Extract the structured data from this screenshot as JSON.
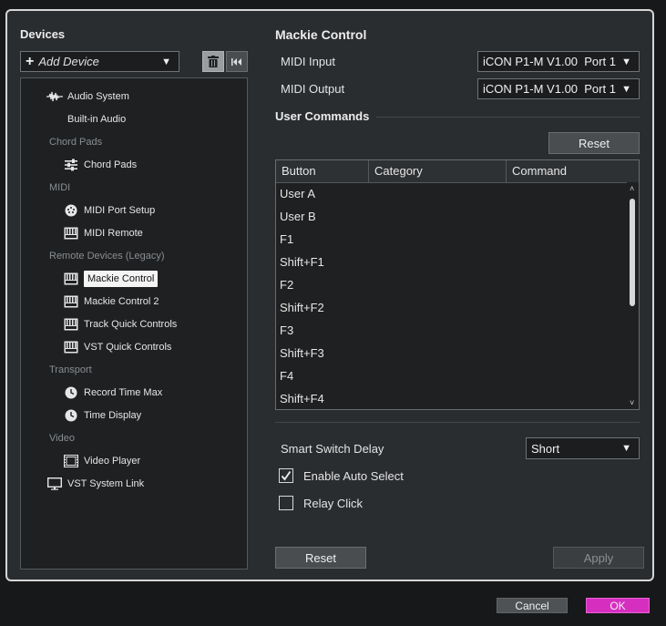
{
  "devices": {
    "title": "Devices",
    "add_device_label": "Add Device",
    "tree": [
      {
        "label": "Audio System",
        "kind": "item",
        "icon": "audio-waveform-icon",
        "indent": 1
      },
      {
        "label": "Built-in Audio",
        "kind": "item",
        "icon": "",
        "indent": 2
      },
      {
        "label": "Chord Pads",
        "kind": "category",
        "icon": "",
        "indent": 1
      },
      {
        "label": "Chord Pads",
        "kind": "item",
        "icon": "sliders-icon",
        "indent": 2
      },
      {
        "label": "MIDI",
        "kind": "category",
        "icon": "",
        "indent": 1
      },
      {
        "label": "MIDI Port Setup",
        "kind": "item",
        "icon": "midi-port-icon",
        "indent": 2
      },
      {
        "label": "MIDI Remote",
        "kind": "item",
        "icon": "keyboard-icon",
        "indent": 2
      },
      {
        "label": "Remote Devices (Legacy)",
        "kind": "category",
        "icon": "",
        "indent": 1
      },
      {
        "label": "Mackie Control",
        "kind": "item",
        "icon": "keyboard-icon",
        "indent": 2,
        "selected": true
      },
      {
        "label": "Mackie Control 2",
        "kind": "item",
        "icon": "keyboard-icon",
        "indent": 2
      },
      {
        "label": "Track Quick Controls",
        "kind": "item",
        "icon": "keyboard-icon",
        "indent": 2
      },
      {
        "label": "VST Quick Controls",
        "kind": "item",
        "icon": "keyboard-icon",
        "indent": 2
      },
      {
        "label": "Transport",
        "kind": "category",
        "icon": "",
        "indent": 1
      },
      {
        "label": "Record Time Max",
        "kind": "item",
        "icon": "clock-icon",
        "indent": 2
      },
      {
        "label": "Time Display",
        "kind": "item",
        "icon": "clock-icon",
        "indent": 2
      },
      {
        "label": "Video",
        "kind": "category",
        "icon": "",
        "indent": 1
      },
      {
        "label": "Video Player",
        "kind": "item",
        "icon": "film-icon",
        "indent": 2
      },
      {
        "label": "VST System Link",
        "kind": "item",
        "icon": "monitor-icon",
        "indent": 1
      }
    ]
  },
  "panel": {
    "title": "Mackie Control",
    "midi_input_label": "MIDI Input",
    "midi_input_value": "iCON P1-M V1.00  Port 1",
    "midi_output_label": "MIDI Output",
    "midi_output_value": "iCON P1-M V1.00  Port 1",
    "user_commands_title": "User Commands",
    "reset_top_label": "Reset",
    "table": {
      "columns": [
        "Button",
        "Category",
        "Command"
      ],
      "rows": [
        "User A",
        "User B",
        "F1",
        "Shift+F1",
        "F2",
        "Shift+F2",
        "F3",
        "Shift+F3",
        "F4",
        "Shift+F4"
      ]
    },
    "smart_switch_label": "Smart Switch Delay",
    "smart_switch_value": "Short",
    "enable_auto_select_label": "Enable Auto Select",
    "enable_auto_select_checked": true,
    "relay_click_label": "Relay Click",
    "relay_click_checked": false,
    "reset_bottom_label": "Reset",
    "apply_label": "Apply"
  },
  "footer": {
    "cancel_label": "Cancel",
    "ok_label": "OK"
  },
  "colors": {
    "accent_ok": "#d62fc0",
    "dialog_border": "#d6d6d6"
  }
}
